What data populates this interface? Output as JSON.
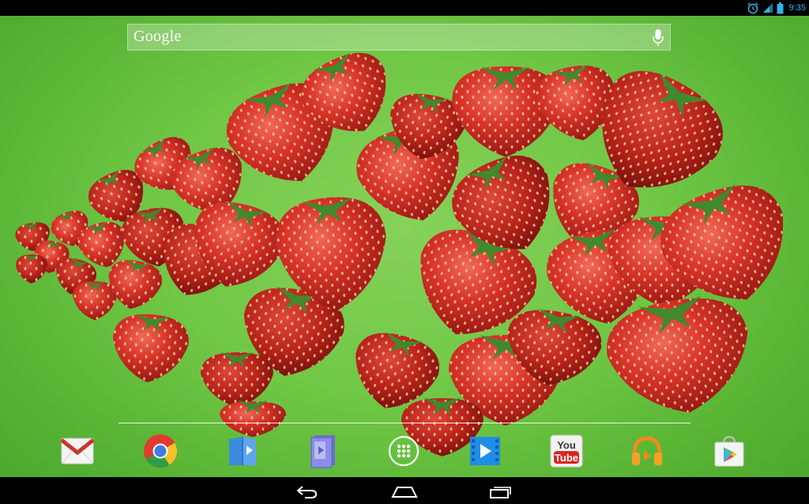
{
  "status_bar": {
    "time": "9:35",
    "icons": [
      "alarm-icon",
      "signal-icon",
      "battery-icon"
    ]
  },
  "search": {
    "logo_text": "Google",
    "mic_icon": "mic-icon"
  },
  "wallpaper": {
    "subject": "strawberries"
  },
  "dock": {
    "apps": [
      {
        "name": "Gmail",
        "icon": "gmail-icon"
      },
      {
        "name": "Chrome",
        "icon": "chrome-icon"
      },
      {
        "name": "Play Books",
        "icon": "play-books-icon"
      },
      {
        "name": "Play Magazines",
        "icon": "play-magazines-icon"
      },
      {
        "name": "Apps",
        "icon": "all-apps-icon"
      },
      {
        "name": "Play Movies",
        "icon": "play-movies-icon"
      },
      {
        "name": "YouTube",
        "icon": "youtube-icon",
        "label_top": "You",
        "label_bottom": "Tube"
      },
      {
        "name": "Play Music",
        "icon": "play-music-icon"
      },
      {
        "name": "Play Store",
        "icon": "play-store-icon"
      }
    ]
  },
  "nav_bar": {
    "buttons": [
      "back-icon",
      "home-icon",
      "recents-icon"
    ]
  },
  "colors": {
    "background_green": "#6fc744",
    "strawberry_red": "#d8322a",
    "status_accent": "#33b5e5"
  }
}
